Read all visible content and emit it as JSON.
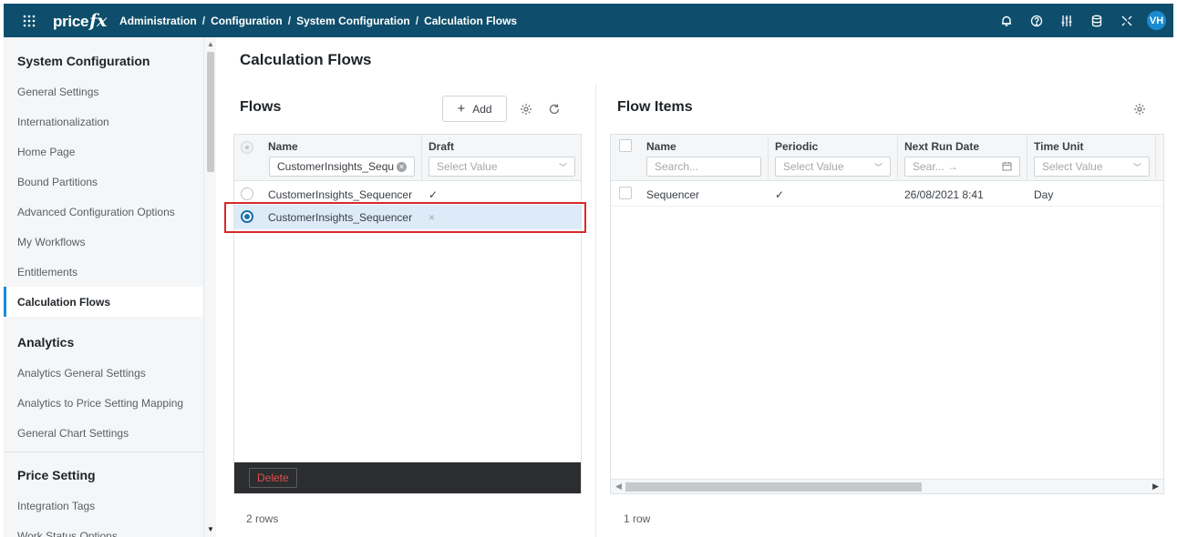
{
  "header": {
    "logo_text": "price",
    "logo_fx": "fx",
    "breadcrumb": [
      "Administration",
      "Configuration",
      "System Configuration",
      "Calculation Flows"
    ],
    "separator": "/",
    "avatar_initials": "VH"
  },
  "sidebar": {
    "sections": [
      {
        "title": "System Configuration",
        "items": [
          "General Settings",
          "Internationalization",
          "Home Page",
          "Bound Partitions",
          "Advanced Configuration Options",
          "My Workflows",
          "Entitlements",
          "Calculation Flows"
        ]
      },
      {
        "title": "Analytics",
        "items": [
          "Analytics General Settings",
          "Analytics to Price Setting Mapping",
          "General Chart Settings"
        ]
      },
      {
        "title": "Price Setting",
        "items": [
          "Integration Tags",
          "Work Status Options"
        ]
      }
    ],
    "active_item": "Calculation Flows"
  },
  "page": {
    "title": "Calculation Flows"
  },
  "flows": {
    "title": "Flows",
    "add_label": "Add",
    "add_glyph": "+",
    "columns": {
      "name": "Name",
      "draft": "Draft"
    },
    "filters": {
      "name_value": "CustomerInsights_Sequ",
      "draft_placeholder": "Select Value"
    },
    "rows": [
      {
        "name": "CustomerInsights_Sequencer",
        "draft": "✓",
        "selected": false
      },
      {
        "name": "CustomerInsights_Sequencer",
        "draft": "×",
        "selected": true
      }
    ],
    "delete_label": "Delete",
    "row_count": "2 rows"
  },
  "flow_items": {
    "title": "Flow Items",
    "columns": {
      "name": "Name",
      "periodic": "Periodic",
      "next_run_date": "Next Run Date",
      "time_unit": "Time Unit"
    },
    "filters": {
      "name_placeholder": "Search...",
      "periodic_placeholder": "Select Value",
      "date_placeholder": "Sear... →",
      "time_unit_placeholder": "Select Value"
    },
    "rows": [
      {
        "name": "Sequencer",
        "periodic": "✓",
        "next_run_date": "26/08/2021 8:41",
        "time_unit": "Day"
      }
    ],
    "row_count": "1 row"
  },
  "colors": {
    "header_bg": "#0e4e6c",
    "accent": "#1a8bd1",
    "selected_row": "#dcebf7",
    "highlight": "#d62a2a",
    "delete": "#e05050"
  }
}
